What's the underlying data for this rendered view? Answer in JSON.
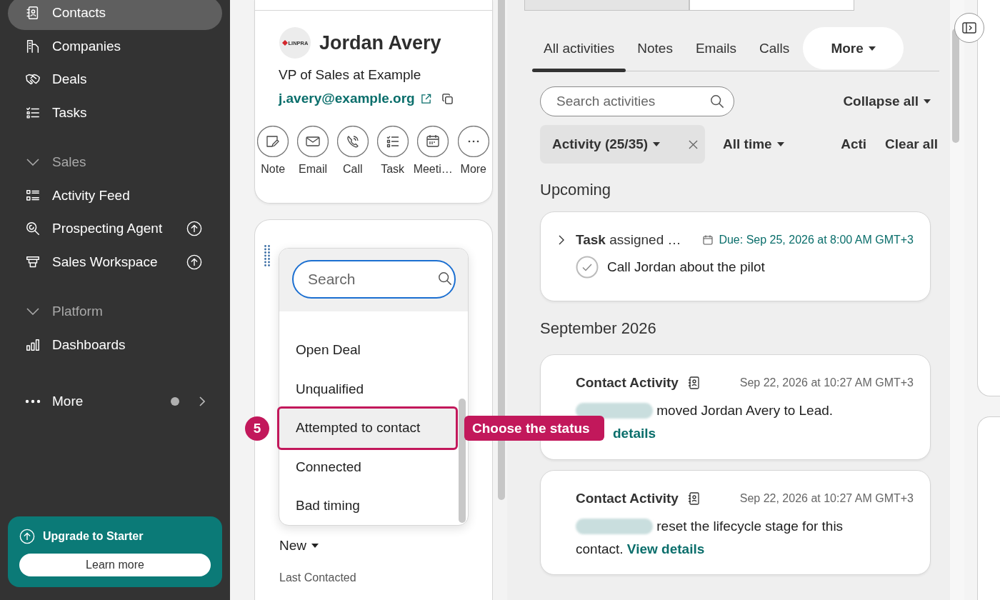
{
  "sidebar": {
    "items": [
      {
        "kind": "nav",
        "label": "Contacts",
        "selected": true,
        "upgrade": false
      },
      {
        "kind": "nav",
        "label": "Companies",
        "selected": false,
        "upgrade": false
      },
      {
        "kind": "nav",
        "label": "Deals",
        "selected": false,
        "upgrade": false
      },
      {
        "kind": "nav",
        "label": "Tasks",
        "selected": false,
        "upgrade": false
      },
      {
        "kind": "section",
        "label": "Sales",
        "expanded": true
      },
      {
        "kind": "nav",
        "label": "Activity Feed",
        "selected": false,
        "upgrade": false
      },
      {
        "kind": "nav",
        "label": "Prospecting Agent",
        "selected": false,
        "upgrade": true
      },
      {
        "kind": "nav",
        "label": "Sales Workspace",
        "selected": false,
        "upgrade": true
      },
      {
        "kind": "section",
        "label": "Platform",
        "expanded": true
      },
      {
        "kind": "nav",
        "label": "Dashboards",
        "selected": false,
        "upgrade": false
      },
      {
        "kind": "more",
        "label": "More",
        "dot": true
      }
    ],
    "upgrade": {
      "title": "Upgrade to Starter",
      "button": "Learn more"
    }
  },
  "contact": {
    "logo_text": "LINPRA",
    "name": "Jordan Avery",
    "job_title": "VP of Sales at Example",
    "email": "j.avery@example.org",
    "actions": [
      "Note",
      "Email",
      "Call",
      "Task",
      "Meeti…",
      "More"
    ]
  },
  "properties": {
    "lead_status": "New",
    "last_contacted_label": "Last Contacted"
  },
  "status_dropdown": {
    "placeholder": "Search",
    "options": [
      {
        "label": "Open Deal",
        "selected": false
      },
      {
        "label": "Unqualified",
        "selected": false
      },
      {
        "label": "Attempted to contact",
        "selected": true
      },
      {
        "label": "Connected",
        "selected": false
      },
      {
        "label": "Bad timing",
        "selected": false
      }
    ]
  },
  "guide": {
    "step": "5",
    "label": "Choose the status"
  },
  "activity": {
    "top_tabs": [
      {
        "selected": false
      },
      {
        "selected": true
      }
    ],
    "tabs": [
      {
        "label": "All activities",
        "selected": true
      },
      {
        "label": "Notes",
        "selected": false
      },
      {
        "label": "Emails",
        "selected": false
      },
      {
        "label": "Calls",
        "selected": false
      }
    ],
    "more_tab": "More",
    "search": {
      "placeholder": "Search activities"
    },
    "collapse": "Collapse all",
    "filters": [
      {
        "kind": "chip",
        "label": "Activity (25/35)"
      },
      {
        "kind": "dropdown",
        "label": "All time"
      },
      {
        "kind": "partial",
        "label": "Acti"
      }
    ],
    "clear": "Clear all",
    "sections": [
      {
        "heading": "Upcoming",
        "items": [
          {
            "kind": "task",
            "title": "**Task** assigned …",
            "due": "Due: Sep 25, 2026 at 8:00 AM GMT+3",
            "task": "Call Jordan about the pilot",
            "completed": false
          }
        ]
      },
      {
        "heading": "September 2026",
        "items": [
          {
            "kind": "activity",
            "title": "Contact Activity",
            "time": "Sep 22, 2026 at 10:27 AM GMT+3",
            "text": "moved Jordan Avery to Lead.",
            "link": "details"
          },
          {
            "kind": "activity",
            "title": "Contact Activity",
            "time": "Sep 22, 2026 at 10:27 AM GMT+3",
            "text": "reset the lifecycle stage for this contact.",
            "link": "View details"
          }
        ]
      }
    ]
  }
}
